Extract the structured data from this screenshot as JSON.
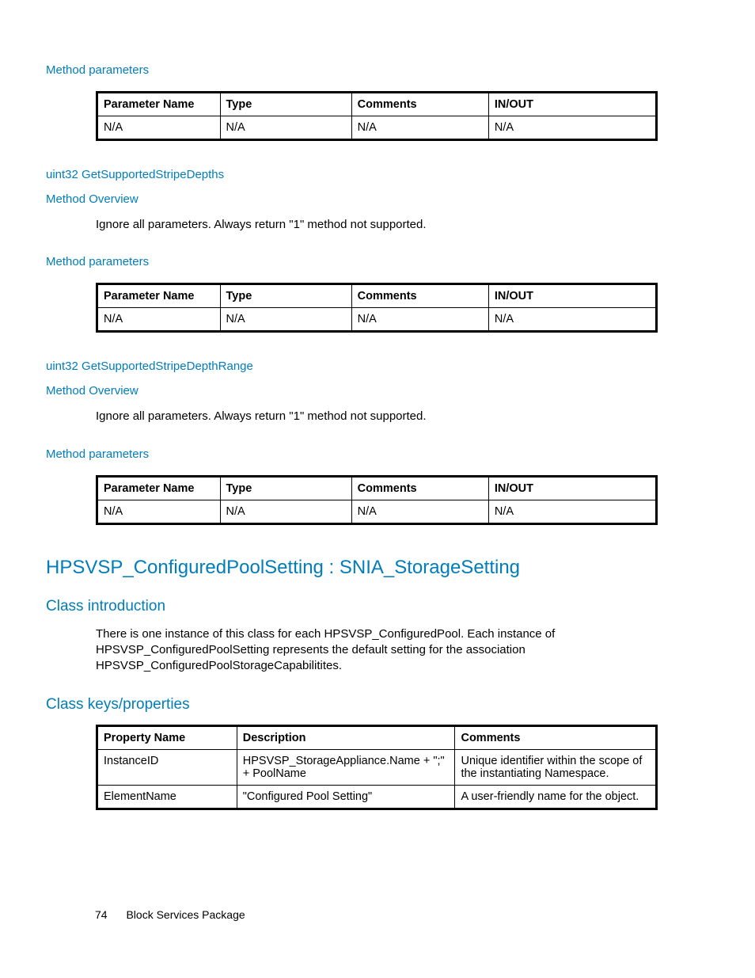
{
  "sections": {
    "s1": {
      "heading": "Method parameters",
      "table": {
        "headers": [
          "Parameter Name",
          "Type",
          "Comments",
          "IN/OUT"
        ],
        "row": [
          "N/A",
          "N/A",
          "N/A",
          "N/A"
        ]
      }
    },
    "s2": {
      "method": "uint32 GetSupportedStripeDepths",
      "overview_heading": "Method Overview",
      "overview_body": "Ignore all parameters. Always return \"1\" method not supported.",
      "params_heading": "Method parameters",
      "table": {
        "headers": [
          "Parameter Name",
          "Type",
          "Comments",
          "IN/OUT"
        ],
        "row": [
          "N/A",
          "N/A",
          "N/A",
          "N/A"
        ]
      }
    },
    "s3": {
      "method": "uint32 GetSupportedStripeDepthRange",
      "overview_heading": "Method Overview",
      "overview_body": "Ignore all parameters. Always return \"1\" method not supported.",
      "params_heading": "Method parameters",
      "table": {
        "headers": [
          "Parameter Name",
          "Type",
          "Comments",
          "IN/OUT"
        ],
        "row": [
          "N/A",
          "N/A",
          "N/A",
          "N/A"
        ]
      }
    },
    "classdef": {
      "title": "HPSVSP_ConfiguredPoolSetting : SNIA_StorageSetting",
      "intro_heading": "Class introduction",
      "intro_body": "There is one instance of this class for each HPSVSP_ConfiguredPool. Each instance of HPSVSP_ConfiguredPoolSetting represents the default setting for the association HPSVSP_ConfiguredPoolStorageCapabilitites.",
      "keys_heading": "Class keys/properties",
      "table": {
        "headers": [
          "Property Name",
          "Description",
          "Comments"
        ],
        "rows": [
          [
            "InstanceID",
            "HPSVSP_StorageAppliance.Name + \";\" + PoolName",
            "Unique identifier within the scope of the instantiating Namespace."
          ],
          [
            "ElementName",
            "\"Configured Pool Setting\"",
            "A user-friendly name for the object."
          ]
        ]
      }
    }
  },
  "footer": {
    "page_number": "74",
    "title": "Block Services Package"
  }
}
